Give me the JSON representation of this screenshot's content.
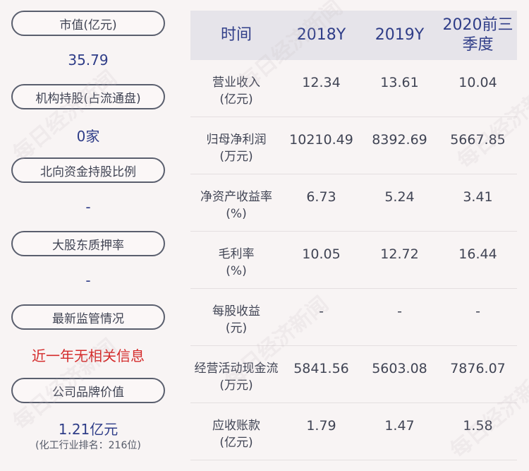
{
  "left_panel": {
    "market_cap_label": "市值(亿元)",
    "market_cap_value": "35.79",
    "institution_label": "机构持股(占流通盘)",
    "institution_value": "0家",
    "northbound_label": "北向资金持股比例",
    "northbound_value": "-",
    "pledge_label": "大股东质押率",
    "pledge_value": "-",
    "regulation_label": "最新监管情况",
    "regulation_value": "近一年无相关信息",
    "brand_label": "公司品牌价值",
    "brand_value": "1.21亿元",
    "brand_rank": "(化工行业排名：216位)"
  },
  "table": {
    "headers": [
      "时间",
      "2018Y",
      "2019Y",
      "2020前三季度"
    ],
    "rows": [
      {
        "label": "营业收入\n(亿元)",
        "values": [
          "12.34",
          "13.61",
          "10.04"
        ]
      },
      {
        "label": "归母净利润\n(万元)",
        "values": [
          "10210.49",
          "8392.69",
          "5667.85"
        ]
      },
      {
        "label": "净资产收益率\n(%)",
        "values": [
          "6.73",
          "5.24",
          "3.41"
        ]
      },
      {
        "label": "毛利率\n(%)",
        "values": [
          "10.05",
          "12.72",
          "16.44"
        ]
      },
      {
        "label": "每股收益\n(元)",
        "values": [
          "-",
          "-",
          "-"
        ]
      },
      {
        "label": "经营活动现金流\n(万元)",
        "values": [
          "5841.56",
          "5603.08",
          "7876.07"
        ]
      },
      {
        "label": "应收账款\n(亿元)",
        "values": [
          "1.79",
          "1.47",
          "1.58"
        ]
      }
    ]
  },
  "watermark": "每日经济新闻"
}
